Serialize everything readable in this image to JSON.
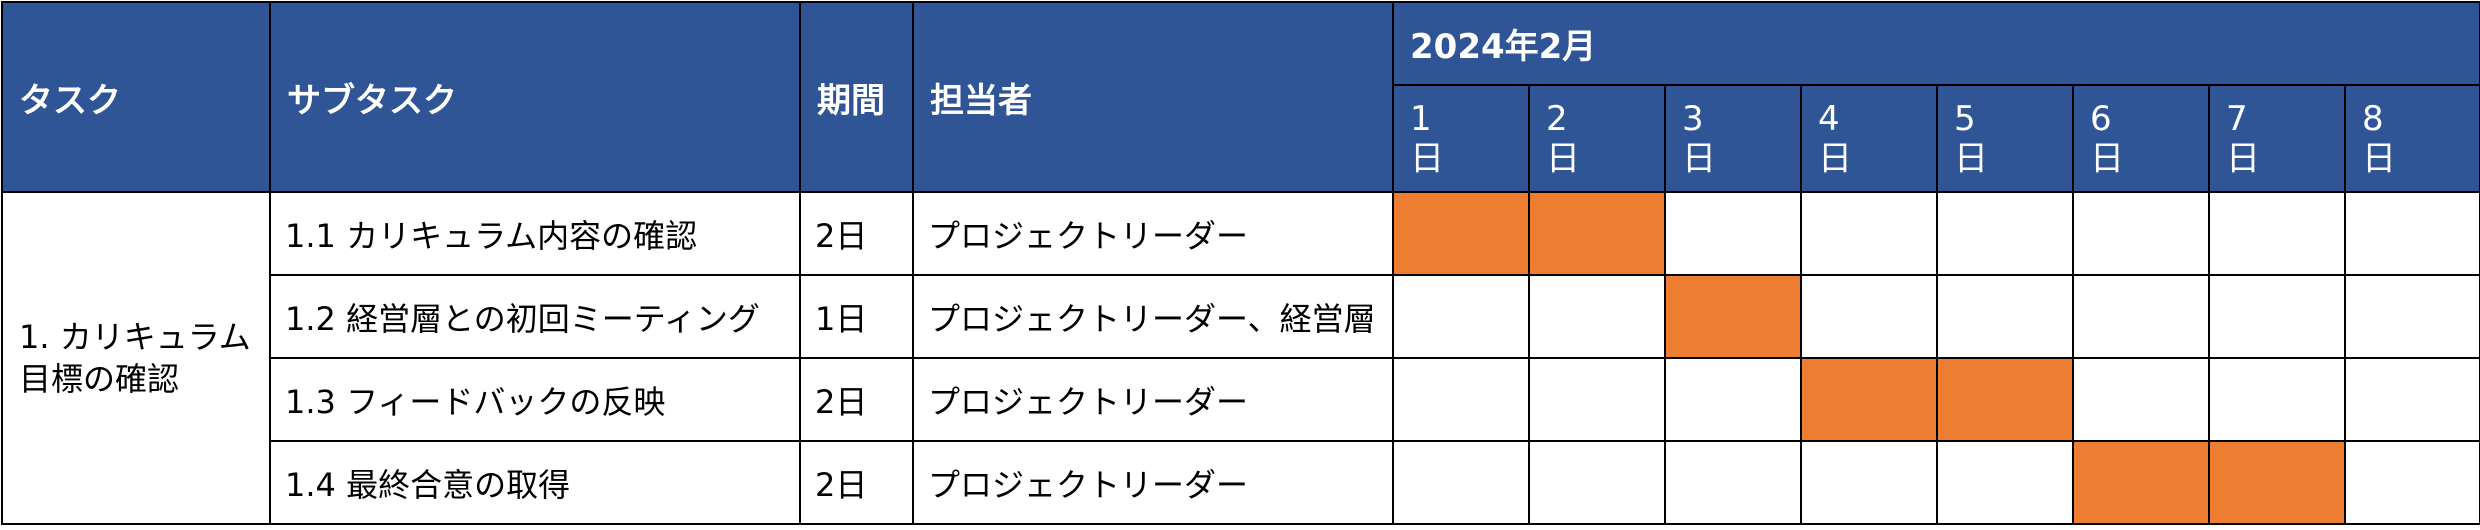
{
  "header": {
    "task": "タスク",
    "subtask": "サブタスク",
    "duration": "期間",
    "owner": "担当者",
    "month": "2024年2月",
    "days": [
      {
        "num": "1",
        "unit": "日"
      },
      {
        "num": "2",
        "unit": "日"
      },
      {
        "num": "3",
        "unit": "日"
      },
      {
        "num": "4",
        "unit": "日"
      },
      {
        "num": "5",
        "unit": "日"
      },
      {
        "num": "6",
        "unit": "日"
      },
      {
        "num": "7",
        "unit": "日"
      },
      {
        "num": "8",
        "unit": "日"
      }
    ]
  },
  "task": {
    "name": "1. カリキュラム目標の確認"
  },
  "rows": [
    {
      "subtask": "1.1 カリキュラム内容の確認",
      "duration": "2日",
      "owner": "プロジェクトリーダー",
      "days": [
        1,
        2
      ]
    },
    {
      "subtask": "1.2 経営層との初回ミーティング",
      "duration": "1日",
      "owner": "プロジェクトリーダー、経営層",
      "days": [
        3
      ]
    },
    {
      "subtask": "1.3 フィードバックの反映",
      "duration": "2日",
      "owner": "プロジェクトリーダー",
      "days": [
        4,
        5
      ]
    },
    {
      "subtask": "1.4 最終合意の取得",
      "duration": "2日",
      "owner": "プロジェクトリーダー",
      "days": [
        6,
        7
      ]
    }
  ],
  "colors": {
    "header_bg": "#2F5597",
    "header_text": "#FFFFFF",
    "bar_fill": "#ED7D31",
    "border": "#000000"
  }
}
